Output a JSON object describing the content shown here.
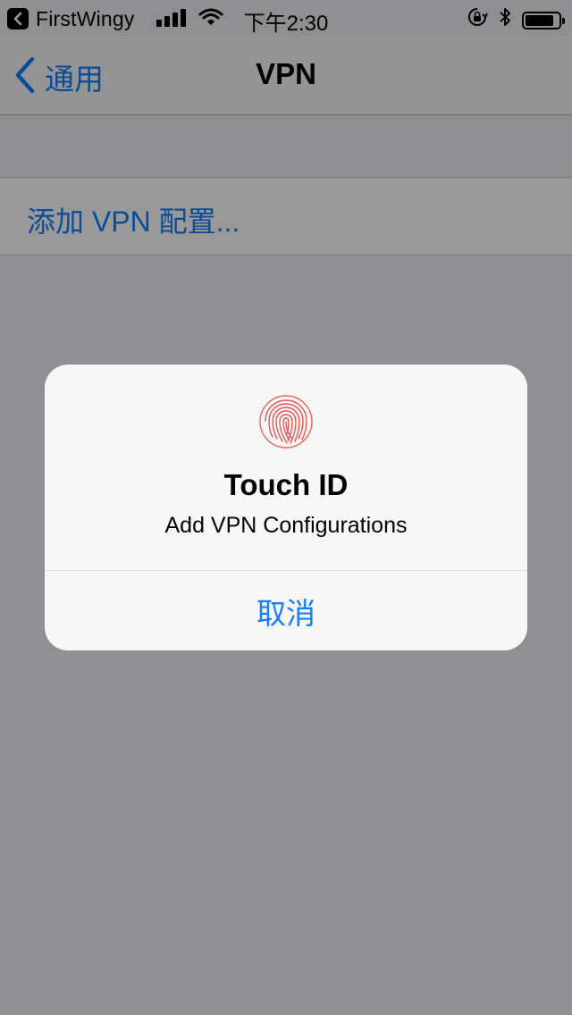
{
  "status_bar": {
    "back_app_label": "FirstWingy",
    "time": "下午2:30",
    "icons": [
      "back-app-icon",
      "signal-icon",
      "wifi-icon",
      "orientation-lock-icon",
      "bluetooth-icon",
      "battery-icon"
    ],
    "battery_level": 0.85
  },
  "nav": {
    "back_label": "通用",
    "title": "VPN"
  },
  "list": {
    "add_vpn_label": "添加 VPN 配置..."
  },
  "alert": {
    "icon": "fingerprint-icon",
    "title": "Touch ID",
    "message": "Add VPN Configurations",
    "cancel_label": "取消"
  },
  "colors": {
    "accent": "#157efb",
    "fingerprint": "#e8554f",
    "background": "#efeff4",
    "dim_overlay": "rgba(0,0,0,0.40)"
  }
}
